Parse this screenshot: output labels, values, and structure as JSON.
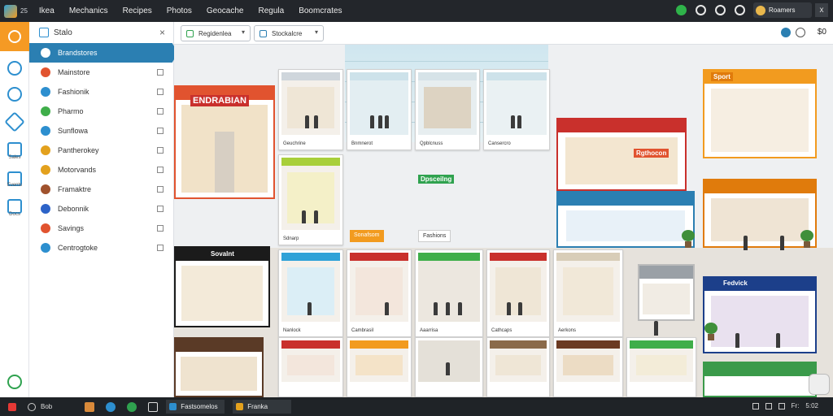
{
  "topbar": {
    "tag": "25",
    "menu": [
      "Ikea",
      "Mechanics",
      "Recipes",
      "Photos",
      "Geocache",
      "Regula",
      "Boomcrates"
    ],
    "user": "Roamers",
    "close": "x"
  },
  "rail": {
    "labels": [
      "Sales",
      "Events",
      "Docs"
    ]
  },
  "sidebar": {
    "title": "Stalo",
    "close": "×",
    "items": [
      {
        "label": "Brandstores",
        "color": "#2b7fb2"
      },
      {
        "label": "Mainstore",
        "color": "#e1532f"
      },
      {
        "label": "Fashionik",
        "color": "#2d8fcf"
      },
      {
        "label": "Pharmo",
        "color": "#3fae4a"
      },
      {
        "label": "Sunflowa",
        "color": "#2d8fcf"
      },
      {
        "label": "Pantherokey",
        "color": "#e3a11d"
      },
      {
        "label": "Motorvands",
        "color": "#e3a11d"
      },
      {
        "label": "Framaktre",
        "color": "#a0522d"
      },
      {
        "label": "Debonnik",
        "color": "#2d63c8"
      },
      {
        "label": "Savings",
        "color": "#e1532f"
      },
      {
        "label": "Centrogtoke",
        "color": "#2d8fcf"
      }
    ]
  },
  "toolbar": {
    "filter_label": "Regidenlea",
    "view_label": "Stockalcre",
    "price": "$0"
  },
  "scene": {
    "signs": [
      "ENDRABIAN",
      "Sport",
      "Fedvick",
      "Sovalnt",
      "Dpsceilng",
      "Rgthocon"
    ],
    "captions": [
      "Geuchrine",
      "Bnmnerot",
      "Qpblcnuss",
      "Cansercro",
      "Sdnarp",
      "Nanlock",
      "Cambrasil",
      "Aaarrisa",
      "Cathcaps",
      "Aerkons"
    ],
    "chips": [
      "Sonafsom",
      "Fashions"
    ]
  },
  "taskbar": {
    "search_label": "Bob",
    "apps": [
      "Fastsomelos",
      "Franka"
    ],
    "tray_time": "5:02",
    "tray_date": "Fr:"
  },
  "colors": {
    "accent": "#2b7fb2",
    "rail_active": "#f59a24",
    "topbar": "#23262b"
  }
}
